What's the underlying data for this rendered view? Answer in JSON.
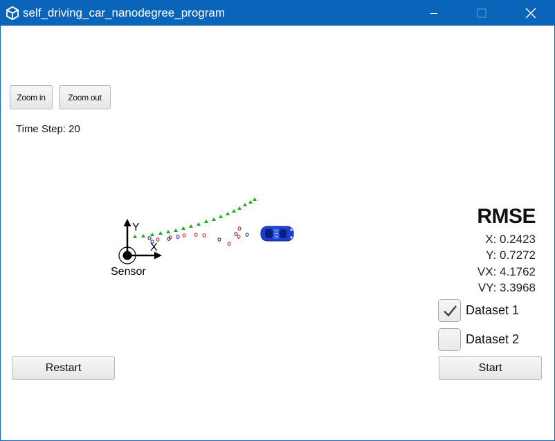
{
  "window": {
    "title": "self_driving_car_nanodegree_program",
    "app_icon": "unity-icon",
    "controls": [
      "minimize-icon",
      "maximize-icon",
      "close-icon"
    ],
    "titlebar_color": "#0a64ba"
  },
  "toolbar": {
    "zoom_in_label": "Zoom in",
    "zoom_out_label": "Zoom out"
  },
  "status": {
    "time_step_label": "Time Step: 20"
  },
  "scene": {
    "sensor_label": "Sensor",
    "x_axis_label": "X",
    "y_axis_label": "Y",
    "vehicle_icon": "car-icon",
    "colors": {
      "estimate": "#15b215",
      "lidar": "#cc1111",
      "radar": "#1111aa",
      "car": "#1e3fd0"
    }
  },
  "rmse": {
    "title": "RMSE",
    "x": "X: 0.2423",
    "y": "Y: 0.7272",
    "vx": "VX: 4.1762",
    "vy": "VY: 3.3968"
  },
  "datasets": [
    {
      "label": "Dataset 1",
      "checked": true
    },
    {
      "label": "Dataset 2",
      "checked": false
    }
  ],
  "actions": {
    "restart_label": "Restart",
    "start_label": "Start"
  }
}
